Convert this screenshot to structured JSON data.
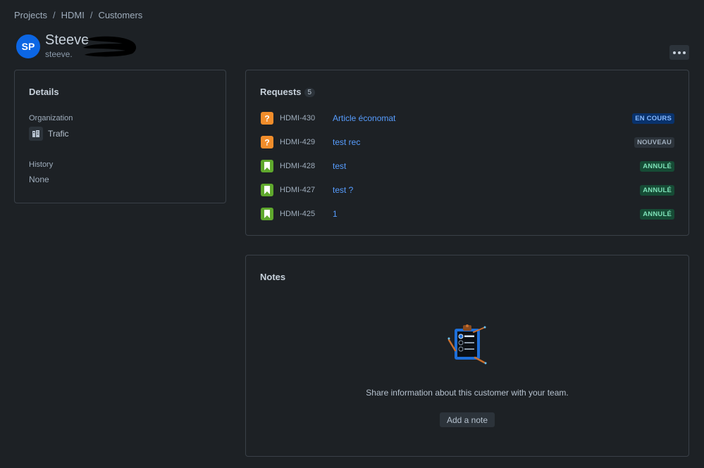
{
  "breadcrumb": [
    {
      "label": "Projects"
    },
    {
      "label": "HDMI"
    },
    {
      "label": "Customers"
    }
  ],
  "customer": {
    "initials": "SP",
    "name": "Steeve",
    "email": "steeve."
  },
  "details": {
    "title": "Details",
    "organization_label": "Organization",
    "organization_value": "Trafic",
    "history_label": "History",
    "history_value": "None"
  },
  "requests": {
    "title": "Requests",
    "count": "5",
    "items": [
      {
        "type": "question",
        "key": "HDMI-430",
        "summary": "Article économat",
        "status": "EN COURS",
        "status_color": "blue"
      },
      {
        "type": "question",
        "key": "HDMI-429",
        "summary": "test rec",
        "status": "NOUVEAU",
        "status_color": "grey"
      },
      {
        "type": "bookmark",
        "key": "HDMI-428",
        "summary": "test",
        "status": "ANNULÉ",
        "status_color": "green"
      },
      {
        "type": "bookmark",
        "key": "HDMI-427",
        "summary": "test ?",
        "status": "ANNULÉ",
        "status_color": "green"
      },
      {
        "type": "bookmark",
        "key": "HDMI-425",
        "summary": "1",
        "status": "ANNULÉ",
        "status_color": "green"
      }
    ]
  },
  "notes": {
    "title": "Notes",
    "empty_message": "Share information about this customer with your team.",
    "add_label": "Add a note"
  },
  "colors": {
    "background": "#1d2125",
    "accent": "#0c66e4",
    "link": "#579dff"
  }
}
